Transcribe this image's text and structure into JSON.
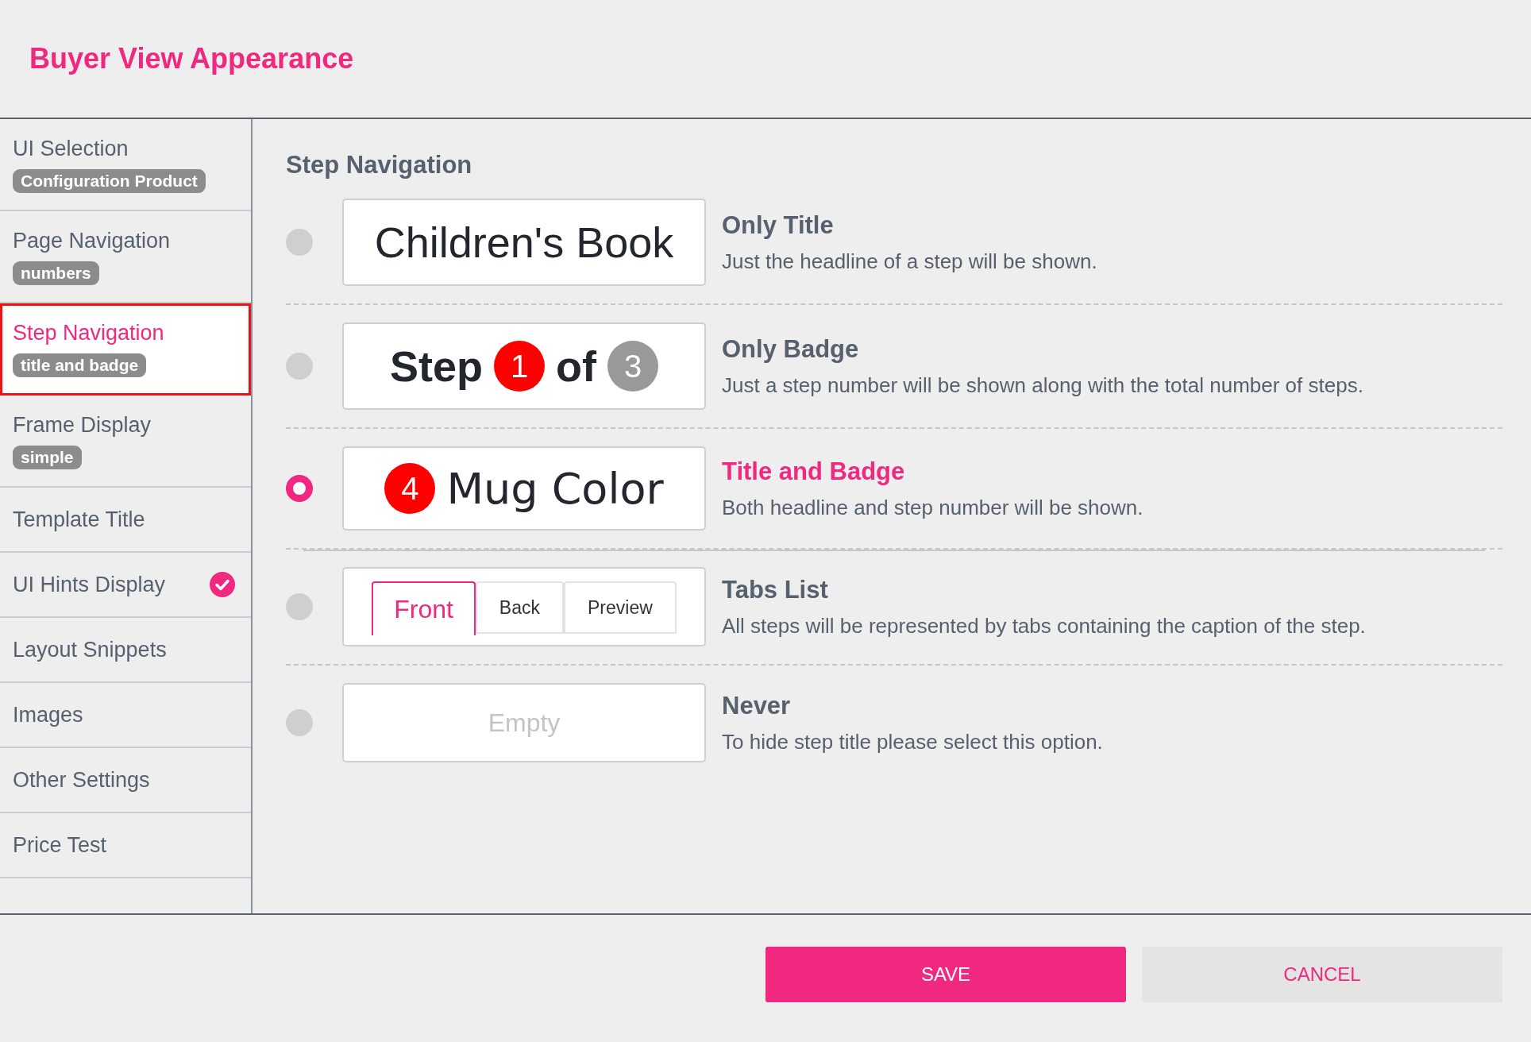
{
  "header": {
    "title": "Buyer View Appearance"
  },
  "sidebar": {
    "items": [
      {
        "label": "UI Selection",
        "badge": "Configuration Product",
        "selected": false,
        "checked": false
      },
      {
        "label": "Page Navigation",
        "badge": "numbers",
        "selected": false,
        "checked": false
      },
      {
        "label": "Step Navigation",
        "badge": "title and badge",
        "selected": true,
        "checked": false
      },
      {
        "label": "Frame Display",
        "badge": "simple",
        "selected": false,
        "checked": false
      },
      {
        "label": "Template Title",
        "selected": false,
        "checked": false
      },
      {
        "label": "UI Hints Display",
        "selected": false,
        "checked": true
      },
      {
        "label": "Layout Snippets",
        "selected": false,
        "checked": false
      },
      {
        "label": "Images",
        "selected": false,
        "checked": false
      },
      {
        "label": "Other Settings",
        "selected": false,
        "checked": false
      },
      {
        "label": "Price Test",
        "selected": false,
        "checked": false
      }
    ]
  },
  "section": {
    "title": "Step Navigation",
    "options": [
      {
        "kind": "title",
        "preview": {
          "title": "Children's Book"
        },
        "title": "Only Title",
        "description": "Just the headline of a step will be shown.",
        "selected": false
      },
      {
        "kind": "badge",
        "preview": {
          "word": "Step",
          "current": "1",
          "joiner": "of",
          "total": "3"
        },
        "title": "Only Badge",
        "description": "Just a step number will be shown along with the total number of steps.",
        "selected": false
      },
      {
        "kind": "title_badge",
        "preview": {
          "badge": "4",
          "title": "Mug Color"
        },
        "title": "Title and Badge",
        "description": "Both headline and step number will be shown.",
        "selected": true
      },
      {
        "kind": "tabs",
        "preview": {
          "tabs": [
            {
              "label": "Front",
              "selected": true
            },
            {
              "label": "Back",
              "selected": false
            },
            {
              "label": "Preview",
              "selected": false
            }
          ]
        },
        "title": "Tabs List",
        "description": "All steps will be represented by tabs containing the caption of the step.",
        "selected": false
      },
      {
        "kind": "empty",
        "preview": {
          "placeholder": "Empty"
        },
        "title": "Never",
        "description": "To hide step title please select this option.",
        "selected": false
      }
    ]
  },
  "footer": {
    "buttons": [
      {
        "label": "SAVE",
        "kind": "primary"
      },
      {
        "label": "CANCEL",
        "kind": "secondary"
      }
    ]
  }
}
